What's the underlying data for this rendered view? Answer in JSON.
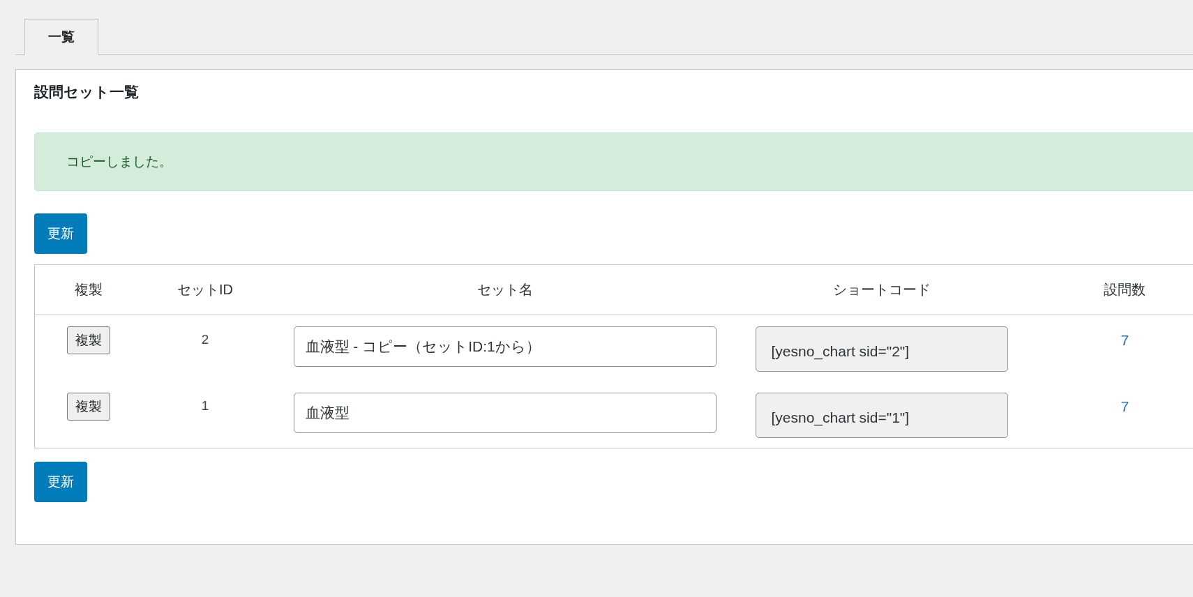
{
  "tabs": [
    {
      "label": "一覧",
      "selected": true
    }
  ],
  "panel": {
    "title": "設問セット一覧",
    "notice": "コピーしました。",
    "update_button_top": "更新",
    "table": {
      "columns": [
        "複製",
        "セットID",
        "セット名",
        "ショートコード",
        "設問数"
      ],
      "rows": [
        {
          "copy_button": "複製",
          "set_id": "2",
          "set_name": "血液型 - コピー（セットID:1から）",
          "shortcode": {
            "value": "[yesno_chart sid=\"2\"]",
            "readonly": true
          },
          "question_count": "7"
        },
        {
          "copy_button": "複製",
          "set_id": "1",
          "set_name": "血液型",
          "shortcode": {
            "value": "[yesno_chart sid=\"1\"]",
            "readonly": true
          },
          "question_count": "7"
        }
      ]
    },
    "update_button_bottom": "更新"
  }
}
